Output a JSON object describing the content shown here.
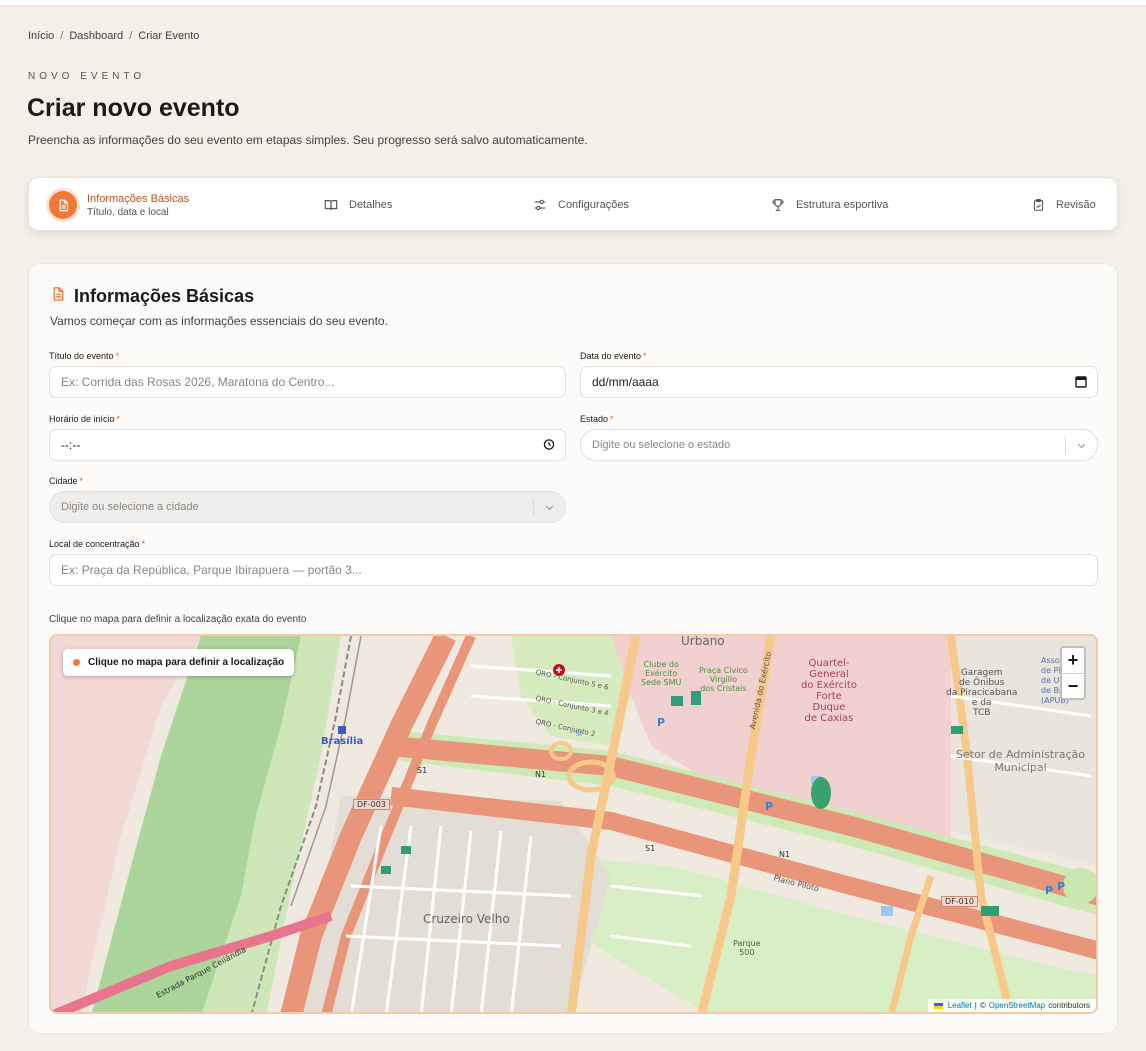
{
  "breadcrumb": {
    "home": "Início",
    "dashboard": "Dashboard",
    "current": "Criar Evento",
    "separator": "/"
  },
  "header": {
    "eyebrow": "NOVO EVENTO",
    "title": "Criar novo evento",
    "subtitle": "Preencha as informações do seu evento em etapas simples. Seu progresso será salvo automaticamente."
  },
  "stepper": {
    "active": {
      "title": "Informações Básicas",
      "description": "Título, data e local",
      "icon": "document-icon"
    },
    "steps": [
      {
        "label": "Detalhes",
        "icon": "book-icon"
      },
      {
        "label": "Configurações",
        "icon": "sliders-icon"
      },
      {
        "label": "Estrutura esportiva",
        "icon": "trophy-icon"
      },
      {
        "label": "Revisão",
        "icon": "clipboard-check-icon"
      }
    ]
  },
  "form": {
    "section_title": "Informações Básicas",
    "section_subtitle": "Vamos começar com as informações essenciais do seu evento.",
    "required_mark": "*",
    "title_label": "Título do evento",
    "title_placeholder": "Ex: Corrida das Rosas 2026, Maratona do Centro...",
    "date_label": "Data do evento",
    "date_value": "dd/mm/aaaa",
    "time_label": "Horário de início",
    "time_value": "--:--",
    "state_label": "Estado",
    "state_placeholder": "Digite ou selecione o estado",
    "city_label": "Cidade",
    "city_placeholder": "Digite ou selecione a cidade",
    "venue_label": "Local de concentração",
    "venue_placeholder": "Ex: Praça da República, Parque Ibirapuera — portão 3...",
    "map_hint": "Clique no mapa para definir a localização exata do evento"
  },
  "map": {
    "pill": "Clique no mapa para definir a localização",
    "zoom_in": "+",
    "zoom_out": "−",
    "attribution": {
      "leaflet": "Leaflet",
      "separator": "|",
      "copyright": "©",
      "osm": "OpenStreetMap",
      "contributors": "contributors"
    },
    "labels": {
      "urbano": "Urbano",
      "brasilia": "Brasília",
      "df003": "DF-003",
      "df010": "DF-010",
      "quartel": [
        "Quartel-",
        "General",
        "do Exército",
        "Forte",
        "Duque",
        "de Caxias"
      ],
      "garagem": [
        "Garagem",
        "de Ônibus",
        "da Piracicabana",
        "e da",
        "TCB"
      ],
      "setor": [
        "Setor de Administração",
        "Municipal"
      ],
      "cruzeiro": "Cruzeiro Velho",
      "plano_piloto": "Plano Piloto",
      "estrada": "Estrada Parque Ceilândia",
      "clube": [
        "Clube do",
        "Exército",
        "Sede SMU"
      ],
      "praca": [
        "Praça Cívico",
        "Virgílio",
        "dos Cristais"
      ],
      "avenida_exercito": "Avenida do Exército",
      "assoc": [
        "Associa",
        "de Pil",
        "de Ultr",
        "de Bra",
        "(APUB)"
      ],
      "qro": [
        "QRO - Conjunto 5 e 6",
        "QRO - Conjunto 3 e 4",
        "QRO - Conjunto 2"
      ],
      "s1": "S1",
      "n1": "N1",
      "parque": [
        "Parque",
        "500"
      ],
      "parking": "P"
    },
    "colors": {
      "road_main": "#e9957a",
      "road_secondary": "#f6c98a",
      "park": "#c9e6b0",
      "forest": "#a9d494",
      "military": "#f1cfcf"
    }
  }
}
